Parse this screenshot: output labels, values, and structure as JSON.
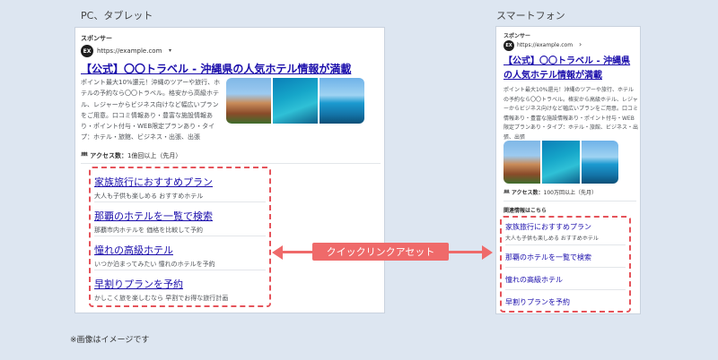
{
  "pc": {
    "section_label": "PC、タブレット",
    "sponsor": "スポンサー",
    "favicon": "EX",
    "url": "https://example.com",
    "caret": "▾",
    "title": "【公式】〇〇トラベル - 沖縄県の人気ホテル情報が満載",
    "description": "ポイント最大10%還元！沖縄のツアーや旅行、ホテルの予約なら〇〇トラベル。格安から高級ホテル、レジャーからビジネス向けなど幅広いプランをご用意。口コミ情報あり・豊富な施設情報あり・ポイント付与・WEB限定プランあり・タイプ：ホテル・旅館、ビジネス・出張、出張",
    "access_icon": "person-icon",
    "access_label": "アクセス数：",
    "access_value": "1億回以上（先月）",
    "quicklinks": [
      {
        "title": "家族旅行におすすめプラン",
        "sub": "大人も子供も楽しめる おすすめホテル"
      },
      {
        "title": "那覇のホテルを一覧で検索",
        "sub": "那覇市内ホテルを 価格を比較して予約"
      },
      {
        "title": "憧れの高級ホテル",
        "sub": "いつか泊まってみたい 憧れのホテルを予約"
      },
      {
        "title": "早割りプランを予約",
        "sub": "かしこく旅を楽しむなら 早割でお得な旅行計画"
      }
    ]
  },
  "sp": {
    "section_label": "スマートフォン",
    "sponsor": "スポンサー",
    "favicon": "EX",
    "url": "https://example.com",
    "caret": "›",
    "title": "【公式】〇〇トラベル - 沖縄県の人気ホテル情報が満載",
    "description": "ポイント最大10%還元！沖縄のツアーや旅行、ホテルの予約なら〇〇トラベル。格安から高級ホテル、レジャーからビジネス向けなど幅広いプランをご用意。口コミ情報あり・豊富な施設情報あり・ポイント付与・WEB限定プランあり・タイプ：ホテル・旅館、ビジネス・出張、出張",
    "access_label": "アクセス数：",
    "access_value": "100万回以上（先月）",
    "related_label": "関連情報はこちら",
    "quicklinks": [
      {
        "title": "家族旅行におすすめプラン",
        "sub": "大人も子供も楽しめる おすすめホテル"
      },
      {
        "title": "那覇のホテルを一覧で検索",
        "sub": ""
      },
      {
        "title": "憧れの高級ホテル",
        "sub": ""
      },
      {
        "title": "早割りプランを予約",
        "sub": ""
      }
    ]
  },
  "callout": {
    "label": "クイックリンクアセット",
    "color": "#ef6a6a"
  },
  "note": "※画像はイメージです"
}
